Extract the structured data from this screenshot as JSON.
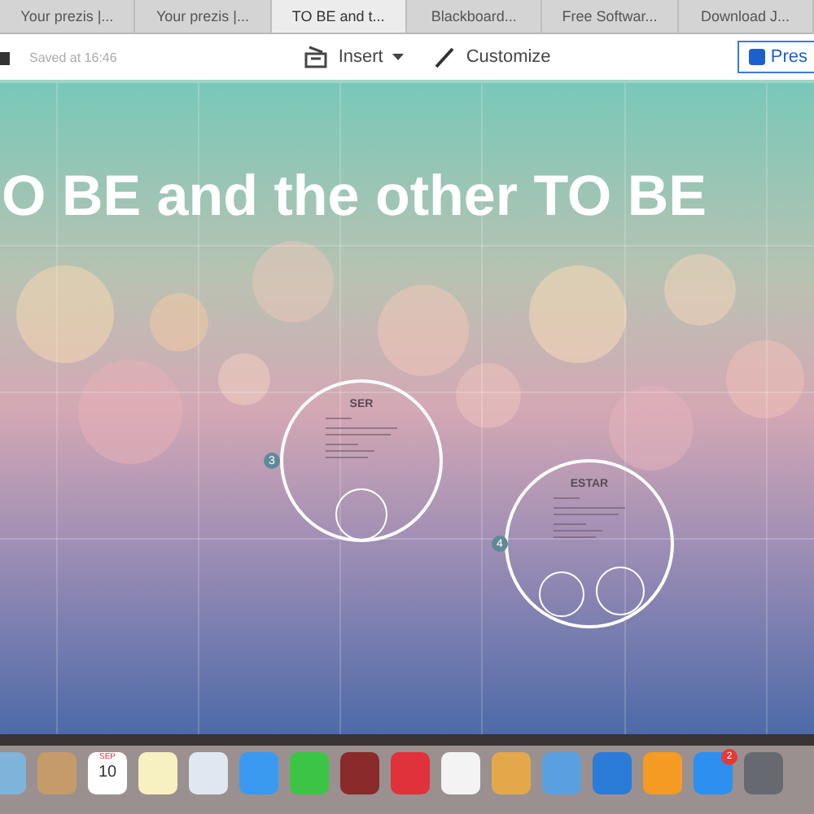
{
  "tabs": [
    {
      "label": "Your prezis |...",
      "selected": false
    },
    {
      "label": "Your prezis |...",
      "selected": false
    },
    {
      "label": "TO BE and t...",
      "selected": true
    },
    {
      "label": "Blackboard...",
      "selected": false
    },
    {
      "label": "Free Softwar...",
      "selected": false
    },
    {
      "label": "Download J...",
      "selected": false
    }
  ],
  "toolbar": {
    "save_status": "Saved at 16:46",
    "insert": "Insert",
    "customize": "Customize",
    "present": "Pres"
  },
  "canvas": {
    "title": "O BE and the other TO BE",
    "frames": [
      {
        "number": "3",
        "heading": "SER"
      },
      {
        "number": "4",
        "heading": "ESTAR"
      }
    ]
  },
  "dock": {
    "calendar_month": "SEP",
    "calendar_day": "10",
    "app_store_badge": "2"
  }
}
